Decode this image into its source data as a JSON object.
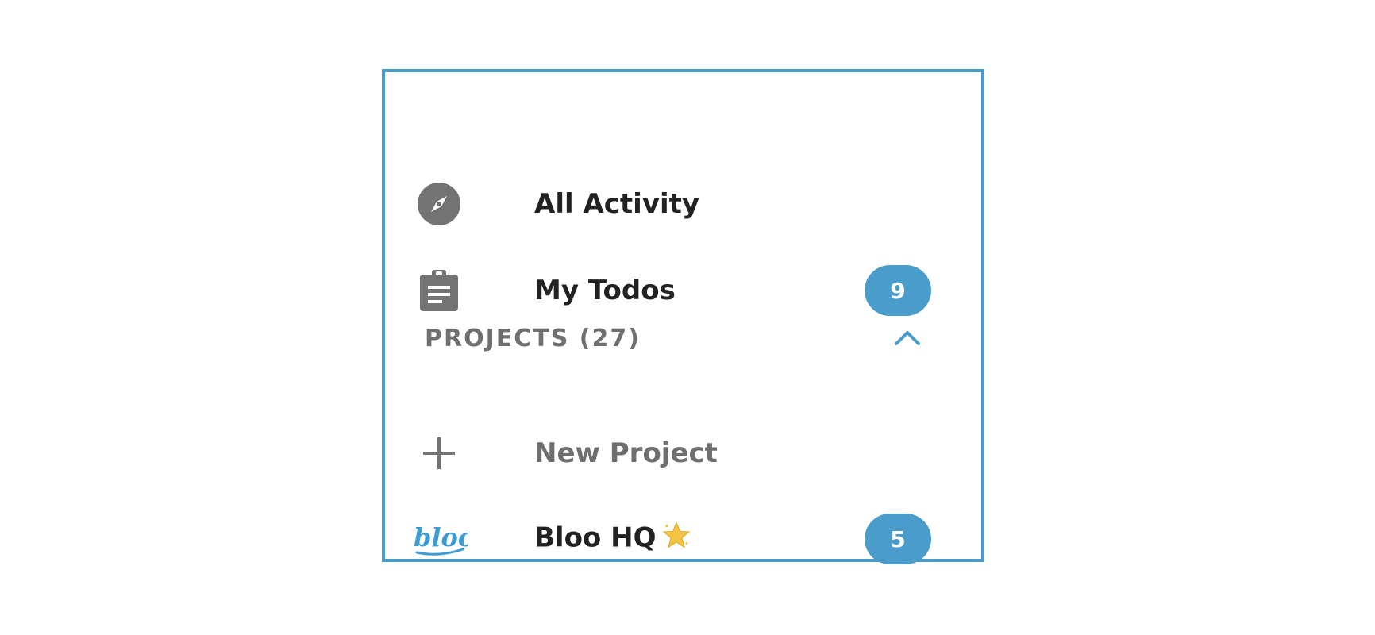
{
  "nav": {
    "all_activity": {
      "label": "All Activity",
      "icon": "compass-icon"
    },
    "my_todos": {
      "label": "My Todos",
      "icon": "clipboard-icon",
      "count": "9"
    }
  },
  "projects": {
    "header": "PROJECTS (27)",
    "toggle_icon": "chevron-up-icon",
    "new_project": {
      "label": "New Project",
      "icon": "plus-icon"
    },
    "items": [
      {
        "label": "Bloo HQ",
        "logo_text": "bloo",
        "emoji": "star-icon",
        "count": "5"
      }
    ]
  },
  "colors": {
    "accent": "#4a9ccb",
    "icon_gray": "#737373",
    "text_dark": "#222222",
    "text_muted": "#6f6f6f",
    "logo_blue": "#3d9bd4",
    "star_gold": "#f4c542"
  }
}
